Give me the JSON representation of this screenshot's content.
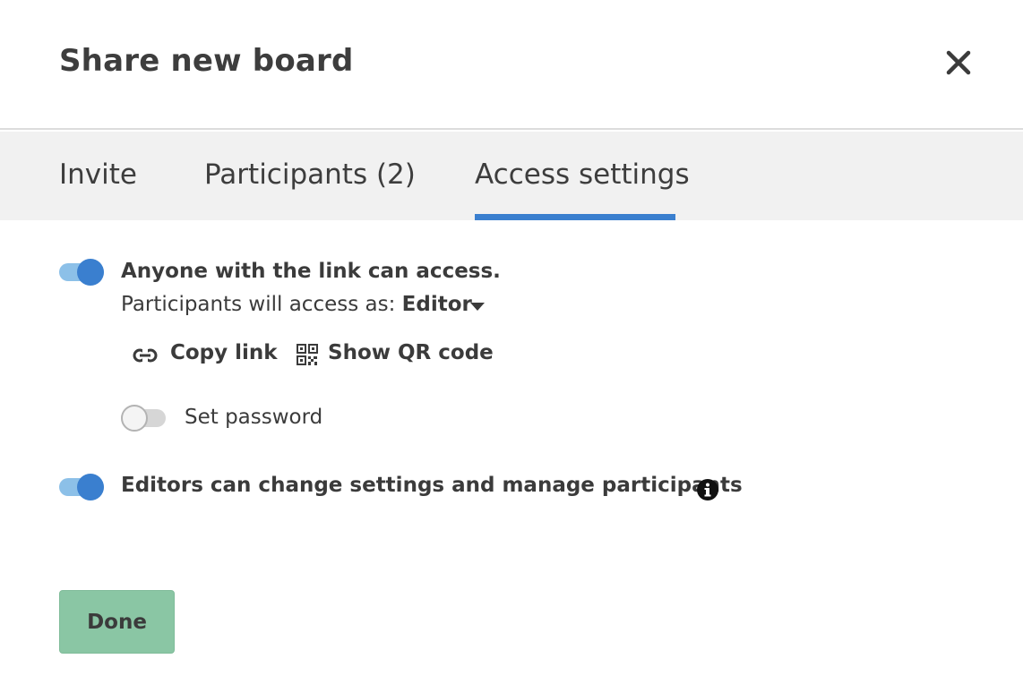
{
  "dialog": {
    "title": "Share new board"
  },
  "tabs": [
    {
      "label": "Invite",
      "active": false
    },
    {
      "label": "Participants (2)",
      "active": false
    },
    {
      "label": "Access settings",
      "active": true
    }
  ],
  "access": {
    "link_access": {
      "enabled": true,
      "label": "Anyone with the link can access."
    },
    "role_prefix": "Participants will access as:",
    "role_value": "Editor",
    "copy_link_label": "Copy link",
    "show_qr_label": "Show QR code",
    "password": {
      "enabled": false,
      "label": "Set password"
    },
    "editors_manage": {
      "enabled": true,
      "label": "Editors can change settings and manage participants"
    }
  },
  "footer": {
    "done_label": "Done"
  },
  "colors": {
    "accent": "#3a7fcf",
    "toggle_track_on": "#8cc0e8",
    "done_button": "#8ac6a4",
    "tab_bar": "#f1f1f1"
  },
  "icons": {
    "close": "close-icon",
    "link": "link-icon",
    "qr": "qr-code-icon",
    "info": "info-icon",
    "caret": "caret-down-icon"
  }
}
